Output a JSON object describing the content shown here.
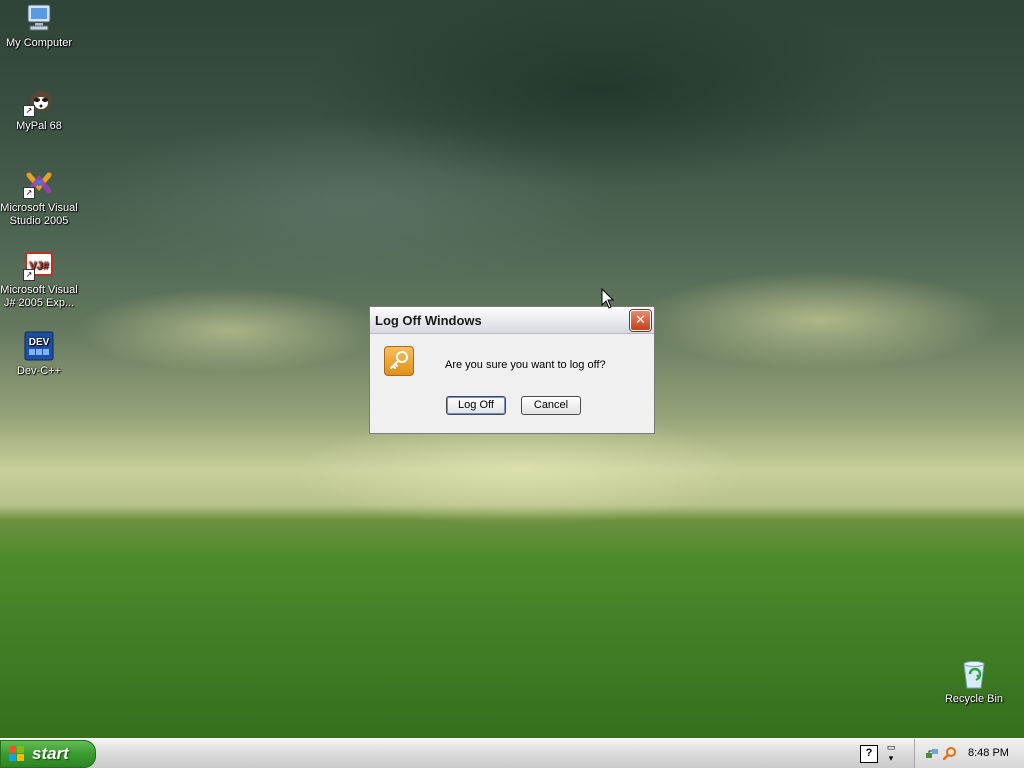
{
  "desktop": {
    "icons": [
      {
        "label": "My Computer",
        "icon": "my-computer-icon"
      },
      {
        "label": "MyPal 68",
        "icon": "mypal-browser-icon"
      },
      {
        "label": "Microsoft Visual Studio 2005",
        "icon": "visual-studio-icon"
      },
      {
        "label": "Microsoft Visual J# 2005 Exp...",
        "icon": "visual-jsharp-icon"
      },
      {
        "label": "Dev-C++",
        "icon": "dev-cpp-icon"
      },
      {
        "label": "Recycle Bin",
        "icon": "recycle-bin-icon"
      }
    ]
  },
  "dialog": {
    "title": "Log Off Windows",
    "message": "Are you sure you want to log off?",
    "logoff_label": "Log Off",
    "cancel_label": "Cancel",
    "icon": "key-icon",
    "close_icon": "close-icon"
  },
  "taskbar": {
    "start_label": "start",
    "help_glyph": "?",
    "clock": "8:48 PM",
    "tray_icons": [
      "network-icon",
      "search-icon"
    ]
  },
  "dev_icon_text": "DEV",
  "vj_icon_text": "VJ#",
  "colors": {
    "start_green": "#3b9b2f",
    "close_red": "#c3401f",
    "dialog_bg": "#f0f0f0"
  }
}
